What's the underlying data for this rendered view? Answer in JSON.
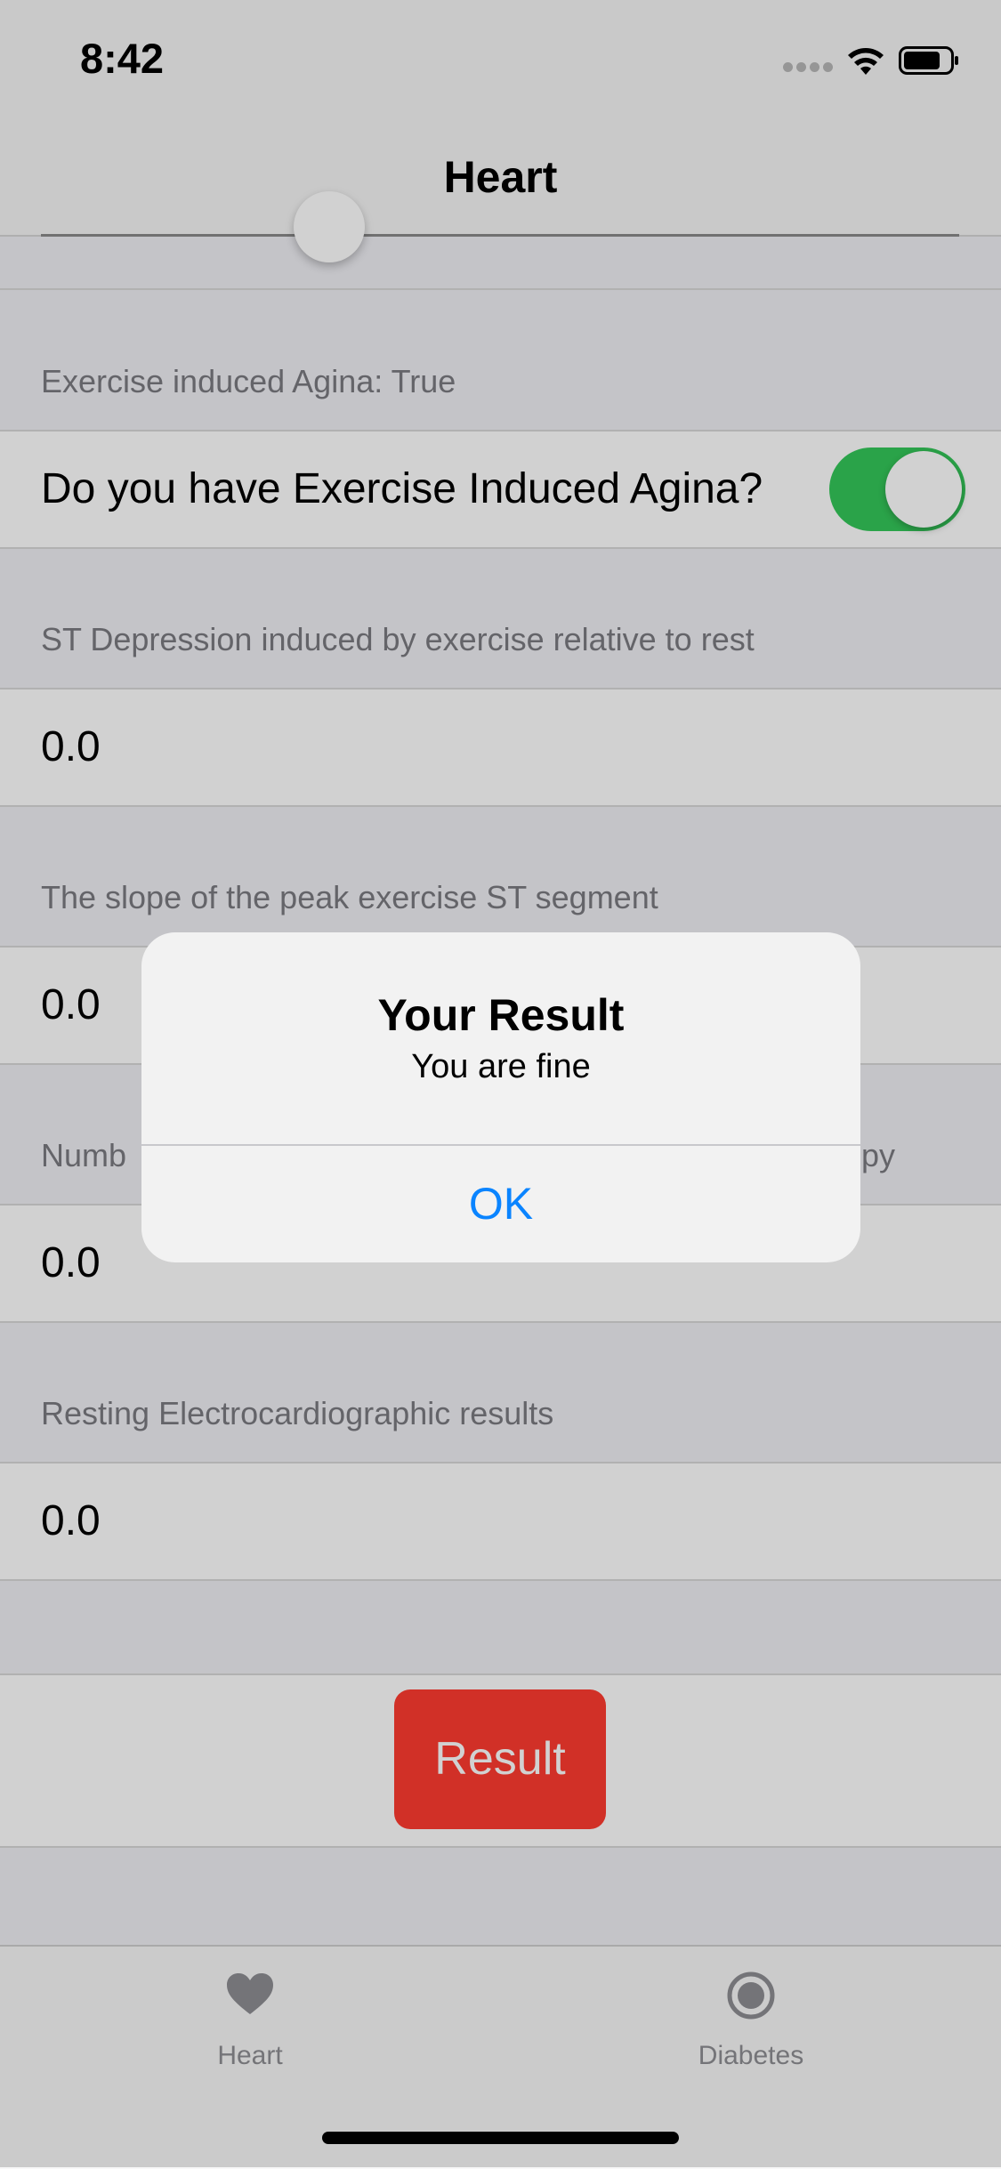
{
  "status_bar": {
    "time": "8:42"
  },
  "nav": {
    "title": "Heart"
  },
  "sections": {
    "angina_header": "Exercise induced Agina: True",
    "angina_question": "Do you have Exercise Induced Agina?",
    "st_depression_header": "ST Depression induced by exercise relative to rest",
    "st_depression_value": "0.0",
    "slope_header": "The slope of the peak exercise ST segment",
    "slope_value": "0.0",
    "vessels_header_left": "Numb",
    "vessels_header_right": "py",
    "vessels_value": "0.0",
    "ecg_header": "Resting Electrocardiographic results",
    "ecg_value": "0.0"
  },
  "toggle": {
    "state": "on",
    "color": "#34c759"
  },
  "result_button": {
    "label": "Result",
    "color": "#ff3b30"
  },
  "tabbar": {
    "tabs": [
      {
        "label": "Heart",
        "icon": "heart-icon",
        "selected": true
      },
      {
        "label": "Diabetes",
        "icon": "target-icon",
        "selected": false
      }
    ]
  },
  "alert": {
    "title": "Your Result",
    "message": "You are fine",
    "ok_label": "OK",
    "ok_color": "#0a84ff"
  }
}
